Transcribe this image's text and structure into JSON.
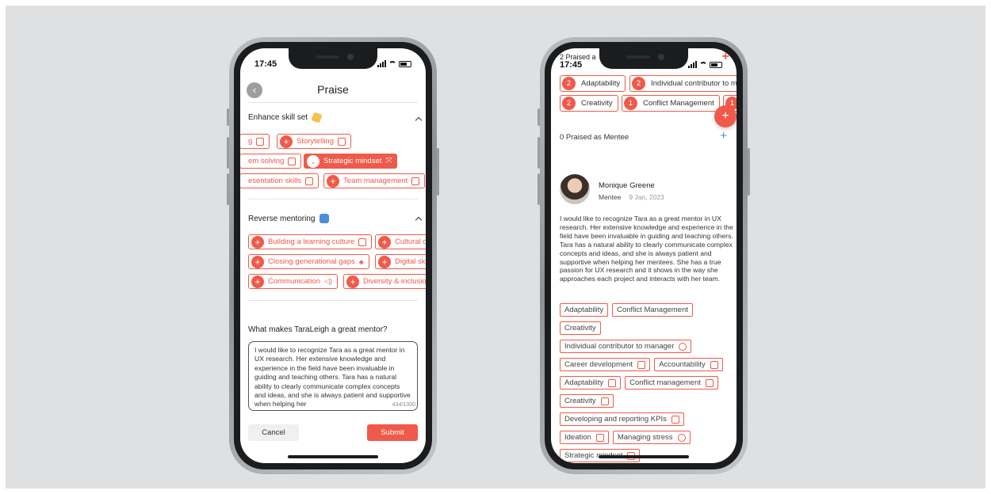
{
  "left_phone": {
    "time": "17:45",
    "title": "Praise",
    "skills_section": {
      "title": "Enhance skill set",
      "chips": [
        {
          "label": "g",
          "selected": false,
          "icon": "cup-icon"
        },
        {
          "label": "Storytelling",
          "selected": false,
          "icon": "book-icon"
        },
        {
          "label": "em solving",
          "selected": false,
          "icon": "checkbox-icon"
        },
        {
          "label": "Strategic mindset",
          "selected": true,
          "icon": "route-icon"
        },
        {
          "label": "esentation skills",
          "selected": false,
          "icon": "monitor-icon"
        },
        {
          "label": "Team management",
          "selected": false,
          "icon": "clipboard-icon"
        }
      ],
      "add_symbol": "+",
      "remove_symbol": "-"
    },
    "reverse_section": {
      "title": "Reverse mentoring",
      "chips": [
        {
          "label": "Building a learning culture",
          "icon": "book-icon"
        },
        {
          "label": "Cultural d",
          "icon": ""
        },
        {
          "label": "Closing generational gaps",
          "icon": "hierarchy-icon"
        },
        {
          "label": "Digital ski",
          "icon": ""
        },
        {
          "label": "Communication",
          "icon": "speaker-icon"
        },
        {
          "label": "Diversity & inclusion",
          "icon": ""
        }
      ]
    },
    "question": "What makes TaraLeigh a great mentor?",
    "answer_text": "I would like to recognize Tara as a great mentor in UX research. Her extensive knowledge and experience in the field have been invaluable in guiding and teaching others. Tara has a natural ability to clearly communicate complex concepts and ideas, and she is always patient and supportive when helping her",
    "char_count": "434/1000",
    "cancel_label": "Cancel",
    "submit_label": "Submit"
  },
  "right_phone": {
    "time": "17:45",
    "overlay_text": "2 Praised a",
    "praised_tags": [
      {
        "count": "2",
        "label": "Adaptability"
      },
      {
        "count": "2",
        "label": "Individual contributor to ma"
      },
      {
        "count": "2",
        "label": "Creativity"
      },
      {
        "count": "1",
        "label": "Conflict Management"
      },
      {
        "count": "1",
        "label": ""
      }
    ],
    "fab_symbol": "+",
    "mentee_heading": "0 Praised as Mentee",
    "mentee_add": "+",
    "reviewer": {
      "name": "Monique Greene",
      "role": "Mentee",
      "date": "9 Jan, 2023"
    },
    "review_text": "I would like to recognize Tara as a great mentor in UX research. Her extensive knowledge and experience in the field have been invaluable in guiding and teaching others. Tara has a natural ability to clearly communicate complex concepts and ideas, and she is always patient and supportive when helping her mentees. She has a true passion for UX research and it shows in the way she approaches each project and interacts with her team.",
    "tag_rows": [
      [
        {
          "label": "Adaptability",
          "icon": ""
        },
        {
          "label": "Conflict Management",
          "icon": ""
        }
      ],
      [
        {
          "label": "Creativity",
          "icon": ""
        }
      ],
      [
        {
          "label": "Individual contributor to manager",
          "icon": "arrow-up-circle-icon"
        }
      ],
      [
        {
          "label": "Career development",
          "icon": "person-icon"
        },
        {
          "label": "Accountability",
          "icon": "person-check-icon"
        }
      ],
      [
        {
          "label": "Adaptability",
          "icon": "route-icon"
        },
        {
          "label": "Conflict management",
          "icon": "arrows-icon"
        }
      ],
      [
        {
          "label": "Creativity",
          "icon": "brush-icon"
        }
      ],
      [
        {
          "label": "Developing and reporting KPIs",
          "icon": "chart-icon"
        }
      ],
      [
        {
          "label": "Ideation",
          "icon": "rocket-icon"
        },
        {
          "label": "Managing stress",
          "icon": "face-icon"
        }
      ],
      [
        {
          "label": "Strategic mindset",
          "icon": "route-icon"
        }
      ]
    ]
  },
  "colors": {
    "accent": "#ef5a4a",
    "background": "#dfe0e1",
    "link_blue": "#3a8fd6"
  }
}
